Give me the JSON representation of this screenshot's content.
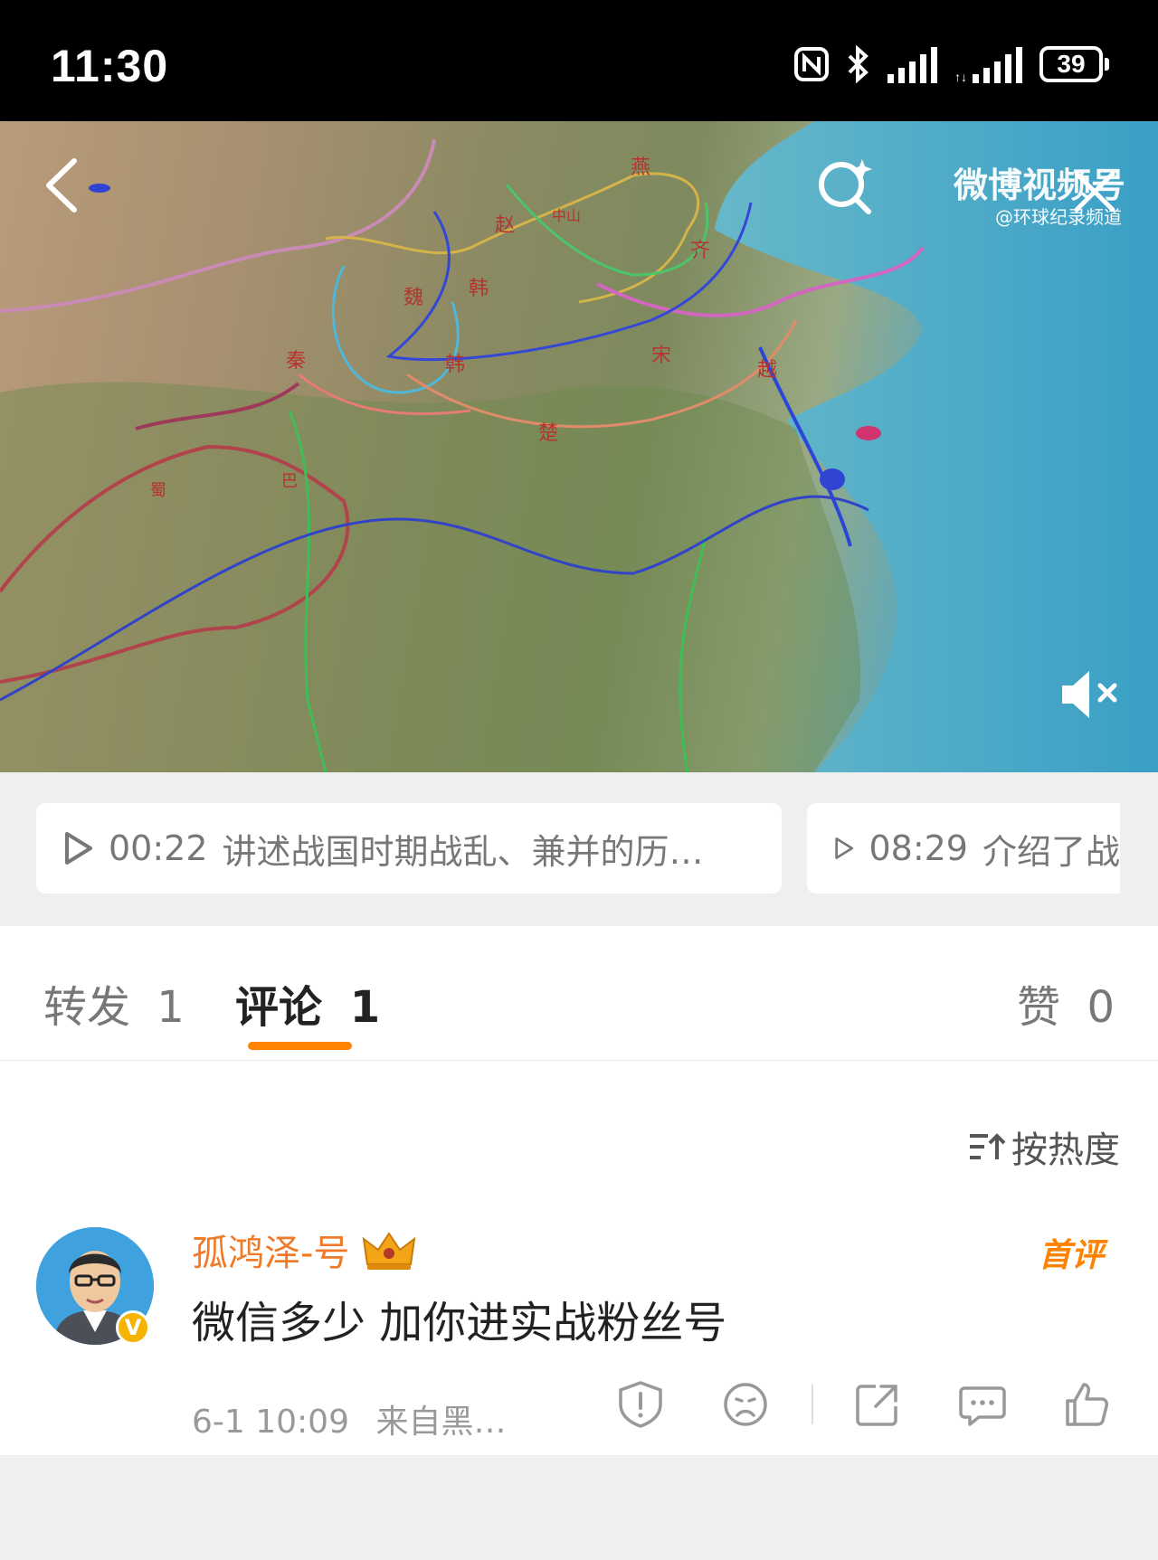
{
  "status_bar": {
    "time": "11:30",
    "battery": "39"
  },
  "video": {
    "watermark_brand": "微博视频号",
    "watermark_channel": "@环球纪录频道",
    "map_labels": [
      "燕",
      "赵",
      "中山",
      "齐",
      "魏",
      "韩",
      "秦",
      "韩",
      "宋",
      "越",
      "楚",
      "蜀",
      "巴"
    ],
    "back_icon": "chevron-left-icon",
    "search_icon": "search-sparkle-icon",
    "close_icon": "close-icon",
    "mute_icon": "volume-muted-icon"
  },
  "chapters": [
    {
      "time": "00:22",
      "text": "讲述战国时期战乱、兼并的历…"
    },
    {
      "time": "08:29",
      "text": "介绍了战"
    }
  ],
  "tabs": [
    {
      "label": "转发",
      "count": "1"
    },
    {
      "label": "评论",
      "count": "1"
    },
    {
      "label": "赞",
      "count": "0"
    }
  ],
  "sort": {
    "label": "按热度",
    "icon": "sort-icon"
  },
  "comment": {
    "username": "孤鸿泽-号",
    "badge": "首评",
    "text": "微信多少 加你进实战粉丝号",
    "time": "6-1 10:09",
    "source": "来自黑…"
  },
  "colors": {
    "accent": "#ff8200",
    "username": "#f07a28",
    "status_bar": "#000000"
  }
}
